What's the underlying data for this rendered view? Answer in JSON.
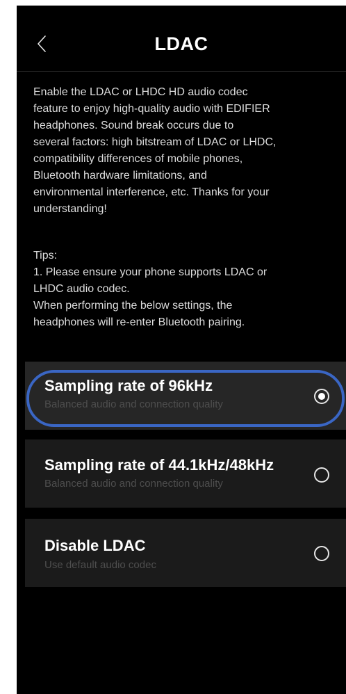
{
  "header": {
    "title": "LDAC",
    "back_icon": "chevron-left-icon"
  },
  "description": "Enable the LDAC or LHDC HD audio codec\nfeature to enjoy high-quality audio with EDIFIER\nheadphones. Sound break occurs due to\nseveral factors: high bitstream of LDAC or LHDC,\ncompatibility differences of mobile phones,\nBluetooth hardware limitations, and\nenvironmental interference, etc. Thanks for your\nunderstanding!",
  "tips": {
    "heading": "Tips:",
    "line1": "1. Please ensure your phone supports LDAC or",
    "line2": "LHDC audio codec.",
    "line3": "When performing the below settings, the",
    "line4": "headphones will re-enter Bluetooth pairing."
  },
  "options": [
    {
      "title": "Sampling rate of 96kHz",
      "subtitle": "Balanced audio and connection quality",
      "selected": true
    },
    {
      "title": "Sampling rate of 44.1kHz/48kHz",
      "subtitle": "Balanced audio and connection quality",
      "selected": false
    },
    {
      "title": "Disable LDAC",
      "subtitle": "Use default audio codec",
      "selected": false
    }
  ],
  "colors": {
    "background": "#000000",
    "card": "#1b1b1b",
    "card_selected": "#262626",
    "highlight_ring": "#3a66c4",
    "text_primary": "#ffffff",
    "text_secondary": "#4e4e4e"
  }
}
